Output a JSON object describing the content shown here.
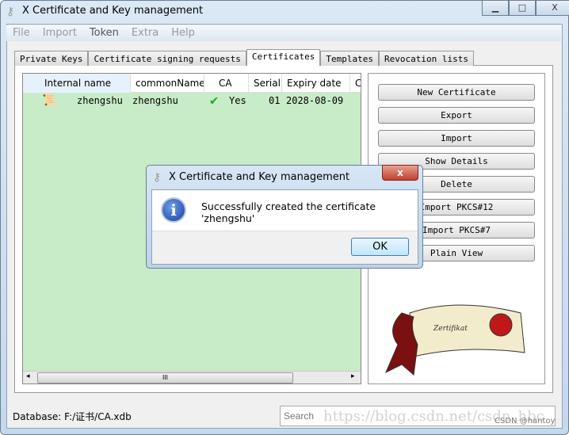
{
  "window": {
    "title": "X Certificate and Key management",
    "minimize": "▁",
    "maximize": "□",
    "close": "X"
  },
  "menu": [
    {
      "label": "File",
      "enabled": false
    },
    {
      "label": "Import",
      "enabled": false
    },
    {
      "label": "Token",
      "enabled": true
    },
    {
      "label": "Extra",
      "enabled": false
    },
    {
      "label": "Help",
      "enabled": false
    }
  ],
  "tabs": [
    {
      "label": "Private Keys"
    },
    {
      "label": "Certificate signing requests"
    },
    {
      "label": "Certificates",
      "active": true
    },
    {
      "label": "Templates"
    },
    {
      "label": "Revocation lists"
    }
  ],
  "table": {
    "columns": [
      "Internal name",
      "commonName",
      "CA",
      "Serial",
      "Expiry date",
      "C"
    ],
    "rows": [
      {
        "internal_name": "zhengshu",
        "common_name": "zhengshu",
        "ca": "Yes",
        "serial": "01",
        "expiry": "2028-08-09"
      }
    ],
    "scroll_grip": "III"
  },
  "buttons": [
    "New Certificate",
    "Export",
    "Import",
    "Show Details",
    "Delete",
    "Import PKCS#12",
    "Import PKCS#7",
    "Plain View"
  ],
  "status": {
    "database": "Database: F:/证书/CA.xdb"
  },
  "search": {
    "placeholder": "Search"
  },
  "watermark": {
    "url": "https://blog.csdn.net/csdn_hbc",
    "credit": "CSDN @hantoy"
  },
  "dialog": {
    "title": "X Certificate and Key management",
    "message": "Successfully created the certificate 'zhengshu'",
    "ok": "OK",
    "close": "x",
    "icon": "info-icon"
  },
  "colors": {
    "table_bg": "#c8ebc8",
    "check": "#22aa22"
  }
}
